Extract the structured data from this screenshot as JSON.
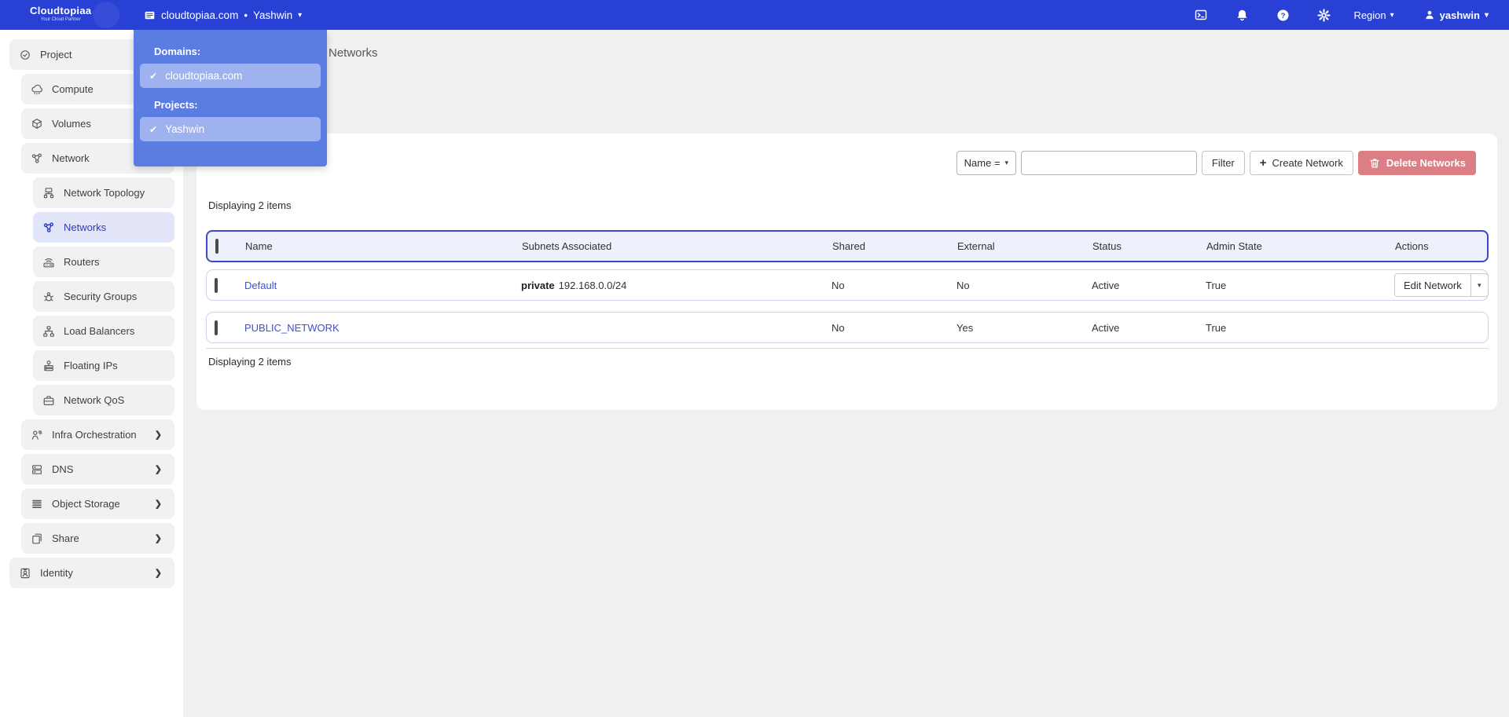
{
  "icons": {
    "check": "✔",
    "caret_down": "▾",
    "chevron_right": "❯",
    "plus": "+",
    "bullet": "•"
  },
  "navbar": {
    "brand": {
      "name": "Cloudtopiaa",
      "tagline": "Your Cloud Partner"
    },
    "context": {
      "domain": "cloudtopiaa.com",
      "separator": "•",
      "project": "Yashwin"
    },
    "right": {
      "icon_buttons": [
        "terminal-icon",
        "bell-icon",
        "help-icon",
        "gear-icon"
      ],
      "region_label": "Region",
      "user_label": "yashwin"
    }
  },
  "domain_dropdown": {
    "domains_label": "Domains:",
    "domains": [
      {
        "label": "cloudtopiaa.com",
        "selected": true
      }
    ],
    "projects_label": "Projects:",
    "projects": [
      {
        "label": "Yashwin",
        "selected": true
      }
    ]
  },
  "sidebar": {
    "items": [
      {
        "label": "Project",
        "icon": "project-icon",
        "level": 0,
        "active": false,
        "expandable": false
      },
      {
        "label": "Compute",
        "icon": "compute-icon",
        "level": 1,
        "active": false,
        "expandable": false
      },
      {
        "label": "Volumes",
        "icon": "volumes-icon",
        "level": 1,
        "active": false,
        "expandable": false
      },
      {
        "label": "Network",
        "icon": "network-icon",
        "level": 1,
        "active": false,
        "expandable": false
      },
      {
        "label": "Network Topology",
        "icon": "network-topology-icon",
        "level": 2,
        "active": false,
        "expandable": false
      },
      {
        "label": "Networks",
        "icon": "networks-icon",
        "level": 2,
        "active": true,
        "expandable": false
      },
      {
        "label": "Routers",
        "icon": "routers-icon",
        "level": 2,
        "active": false,
        "expandable": false
      },
      {
        "label": "Security Groups",
        "icon": "security-groups-icon",
        "level": 2,
        "active": false,
        "expandable": false
      },
      {
        "label": "Load Balancers",
        "icon": "load-balancers-icon",
        "level": 2,
        "active": false,
        "expandable": false
      },
      {
        "label": "Floating IPs",
        "icon": "floating-ips-icon",
        "level": 2,
        "active": false,
        "expandable": false
      },
      {
        "label": "Network QoS",
        "icon": "network-qos-icon",
        "level": 2,
        "active": false,
        "expandable": false
      },
      {
        "label": "Infra Orchestration",
        "icon": "infra-orchestration-icon",
        "level": 1,
        "active": false,
        "expandable": true
      },
      {
        "label": "DNS",
        "icon": "dns-icon",
        "level": 1,
        "active": false,
        "expandable": true
      },
      {
        "label": "Object Storage",
        "icon": "object-storage-icon",
        "level": 1,
        "active": false,
        "expandable": true
      },
      {
        "label": "Share",
        "icon": "share-icon",
        "level": 1,
        "active": false,
        "expandable": true
      },
      {
        "label": "Identity",
        "icon": "identity-icon",
        "level": 0,
        "active": false,
        "expandable": true
      }
    ]
  },
  "page": {
    "title": "Networks"
  },
  "toolbar": {
    "filter_field_label": "Name =",
    "search_value": "",
    "filter_button": "Filter",
    "create_button": "Create Network",
    "delete_button": "Delete Networks"
  },
  "table": {
    "count_top": "Displaying 2 items",
    "count_bottom": "Displaying 2 items",
    "columns": [
      "Name",
      "Subnets Associated",
      "Shared",
      "External",
      "Status",
      "Admin State",
      "Actions"
    ],
    "rows": [
      {
        "name": "Default",
        "subnet_name": "private",
        "subnet_cidr": "192.168.0.0/24",
        "shared": "No",
        "external": "No",
        "status": "Active",
        "admin_state": "True",
        "action": "Edit Network"
      },
      {
        "name": "PUBLIC_NETWORK",
        "subnet_name": "",
        "subnet_cidr": "",
        "shared": "No",
        "external": "Yes",
        "status": "Active",
        "admin_state": "True",
        "action": ""
      }
    ]
  },
  "colors": {
    "navbar": "#2840d4",
    "dropdown_panel": "#5b7ce1",
    "dropdown_item": "#9db2ef",
    "sidebar_active_bg": "#e3e6f8",
    "sidebar_active_text": "#2b3bc7",
    "table_header_border": "#3949c9",
    "table_header_bg": "#eef0fb",
    "link": "#3a51d4",
    "delete_button": "#db7f85",
    "main_bg": "#f0f0f1"
  }
}
